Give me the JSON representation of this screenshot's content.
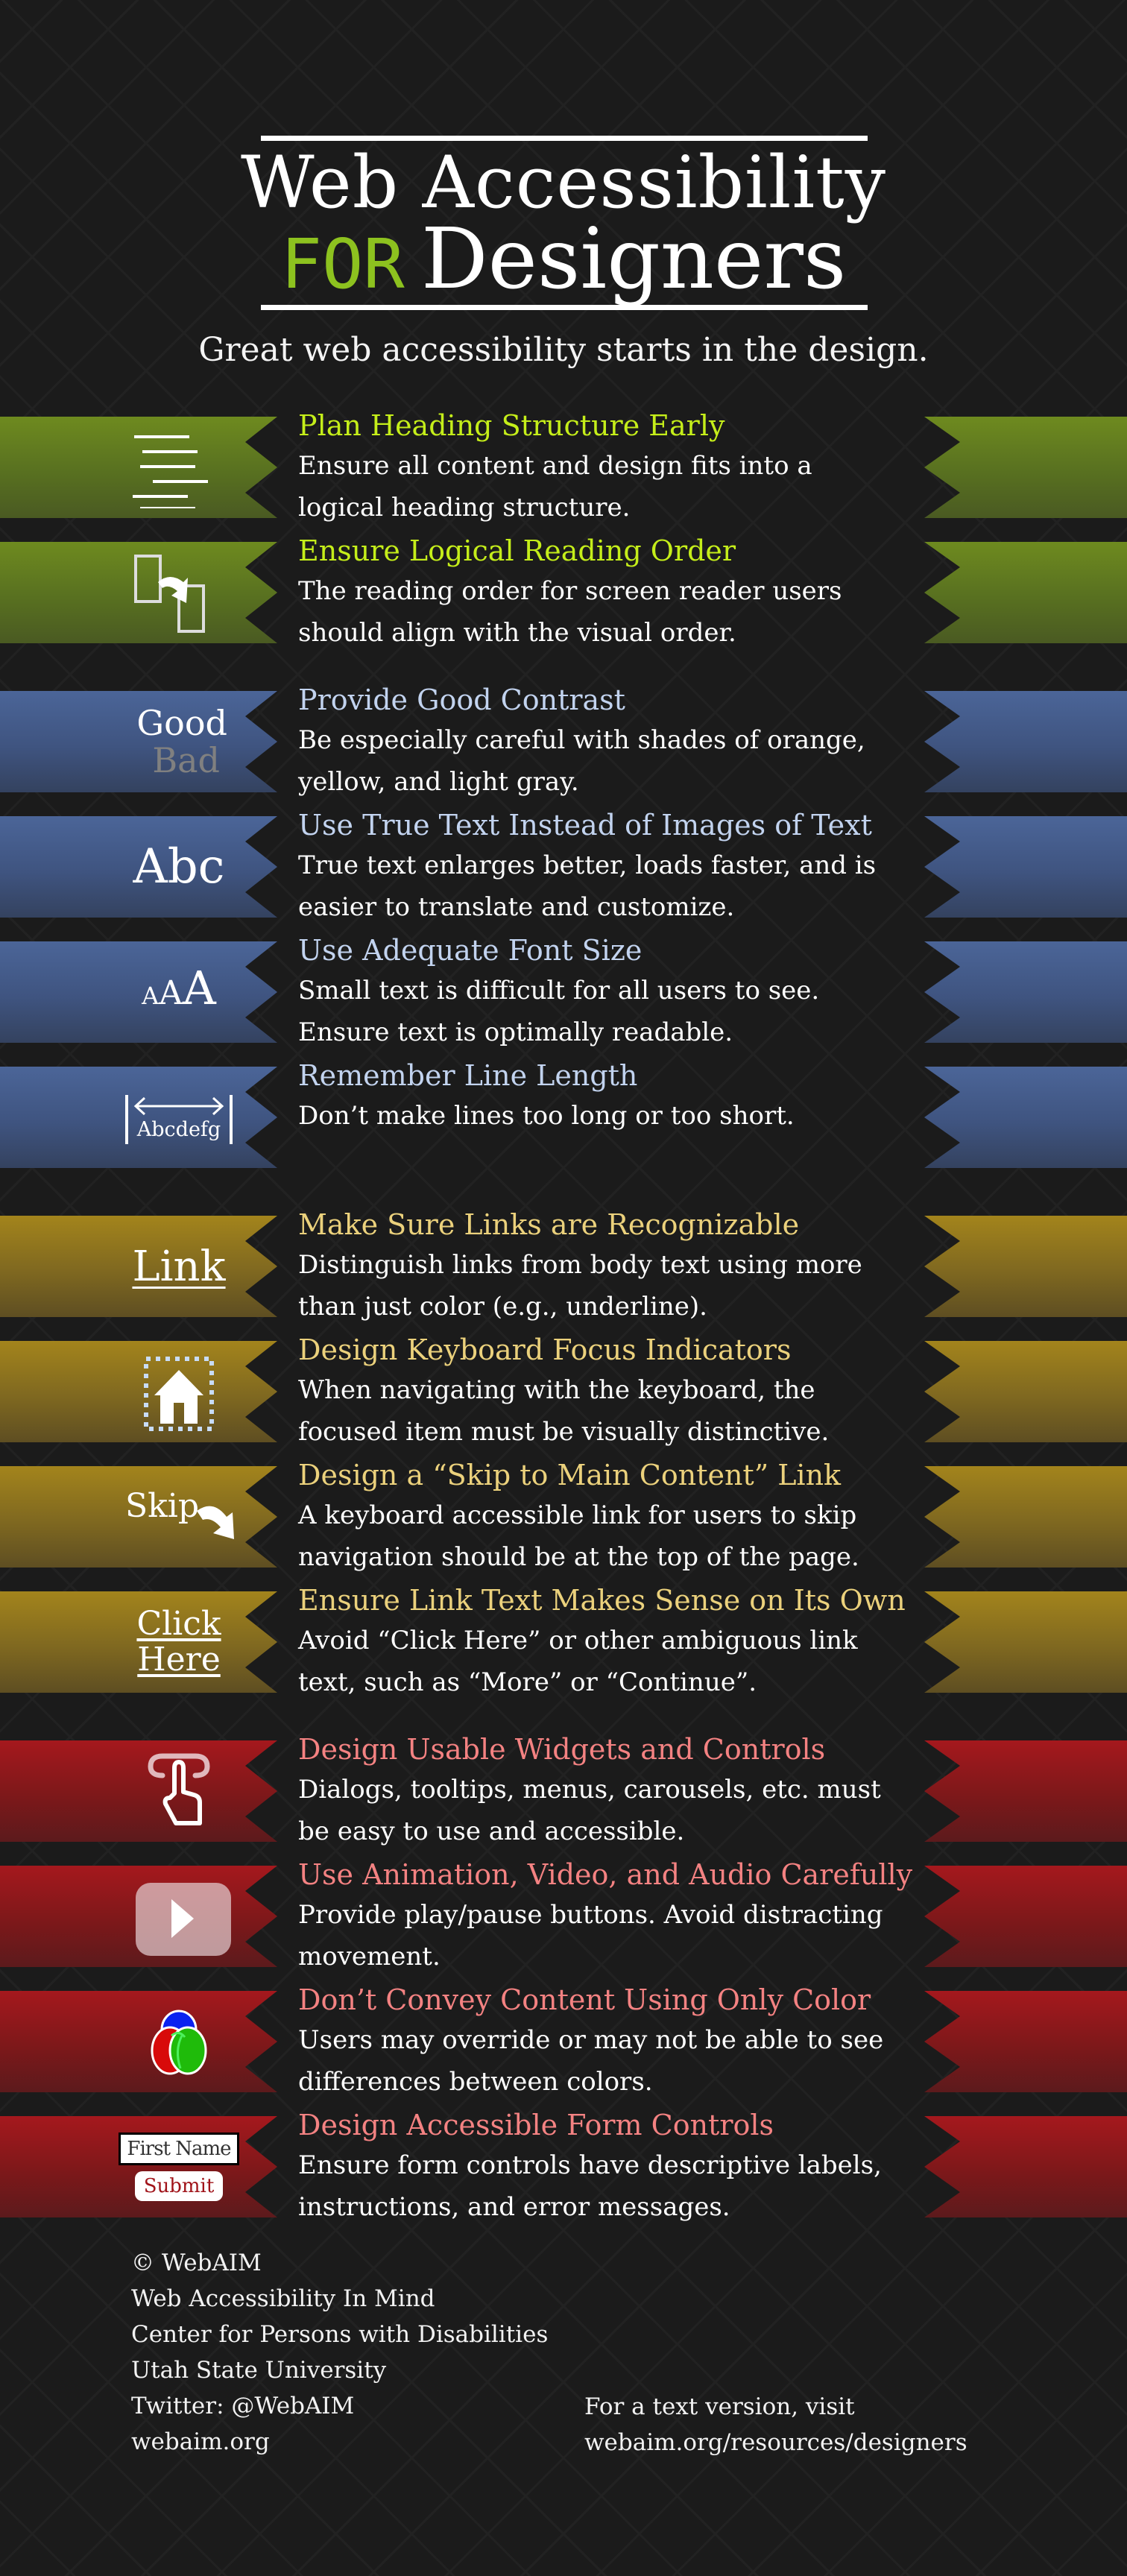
{
  "header": {
    "title_line1": "Web Accessibility",
    "title_for": "FOR",
    "title_designers": "Designers",
    "tagline": "Great web accessibility starts in the design."
  },
  "colors": {
    "background": "#1b1b1b",
    "green_heading": "#c5ee1a",
    "blue_heading": "#c2d3ef",
    "yellow_heading": "#ebd17c",
    "red_heading": "#f48282",
    "green_ribbon": "#6e8a1f",
    "blue_ribbon": "#4b6598",
    "yellow_ribbon": "#a3841c",
    "red_ribbon": "#a5181d"
  },
  "items": [
    {
      "icon": "heading-structure-icon",
      "heading": "Plan Heading Structure Early",
      "desc_lines": [
        "Ensure all content and design fits into a",
        "logical heading structure."
      ]
    },
    {
      "icon": "reading-order-icon",
      "heading": "Ensure Logical Reading Order",
      "desc_lines": [
        "The reading order for screen reader users",
        "should align with the visual order."
      ]
    },
    {
      "icon": "contrast-icon",
      "icon_text": [
        "Good",
        "Bad"
      ],
      "heading": "Provide Good Contrast",
      "desc_lines": [
        "Be especially careful with shades of orange,",
        "yellow, and light gray."
      ]
    },
    {
      "icon": "true-text-icon",
      "icon_text": [
        "Abc"
      ],
      "heading": "Use True Text Instead of Images of Text",
      "desc_lines": [
        "True text enlarges better, loads faster, and is",
        "easier to translate and customize."
      ]
    },
    {
      "icon": "font-size-icon",
      "icon_text": [
        "A",
        "A",
        "A"
      ],
      "heading": "Use Adequate Font Size",
      "desc_lines": [
        "Small text is difficult for all users to see.",
        "Ensure text is optimally readable."
      ]
    },
    {
      "icon": "line-length-icon",
      "icon_text": [
        "Abcdefg"
      ],
      "heading": "Remember Line Length",
      "desc_lines": [
        "Don’t make lines too long or too short."
      ]
    },
    {
      "icon": "link-underline-icon",
      "icon_text": [
        "Link"
      ],
      "heading": "Make Sure Links are Recognizable",
      "desc_lines": [
        "Distinguish links from body text using more",
        "than just color (e.g., underline)."
      ]
    },
    {
      "icon": "focus-home-icon",
      "heading": "Design Keyboard Focus Indicators",
      "desc_lines": [
        "When navigating with the keyboard, the",
        "focused item must be visually distinctive."
      ]
    },
    {
      "icon": "skip-arrow-icon",
      "icon_text": [
        "Skip"
      ],
      "heading": "Design a “Skip to Main Content” Link",
      "desc_lines": [
        "A keyboard accessible link for users to skip",
        "navigation should be at the top of the page."
      ]
    },
    {
      "icon": "click-here-icon",
      "icon_text": [
        "Click",
        "Here"
      ],
      "heading": "Ensure Link Text Makes Sense on Its Own",
      "desc_lines": [
        "Avoid “Click Here” or other ambiguous link",
        "text, such as “More” or “Continue”."
      ]
    },
    {
      "icon": "touch-hand-icon",
      "heading": "Design Usable Widgets and Controls",
      "desc_lines": [
        "Dialogs, tooltips, menus, carousels, etc. must",
        "be easy to use and accessible."
      ]
    },
    {
      "icon": "play-button-icon",
      "heading": "Use Animation, Video, and Audio Carefully",
      "desc_lines": [
        "Provide play/pause buttons. Avoid distracting",
        "movement."
      ]
    },
    {
      "icon": "color-circles-icon",
      "heading": "Don’t Convey Content Using Only Color",
      "desc_lines": [
        "Users may override or may not be able to see",
        "differences between colors."
      ]
    },
    {
      "icon": "form-controls-icon",
      "icon_text": [
        "First Name",
        "Submit"
      ],
      "heading": "Design Accessible Form Controls",
      "desc_lines": [
        "Ensure form controls have descriptive labels,",
        "instructions, and error messages."
      ]
    }
  ],
  "footer": {
    "left_lines": [
      "© WebAIM",
      "Web Accessibility In Mind",
      "Center for Persons with Disabilities",
      "Utah State University",
      "Twitter: @WebAIM",
      "webaim.org"
    ],
    "right_lines": [
      "For a text version, visit",
      "webaim.org/resources/designers"
    ]
  }
}
